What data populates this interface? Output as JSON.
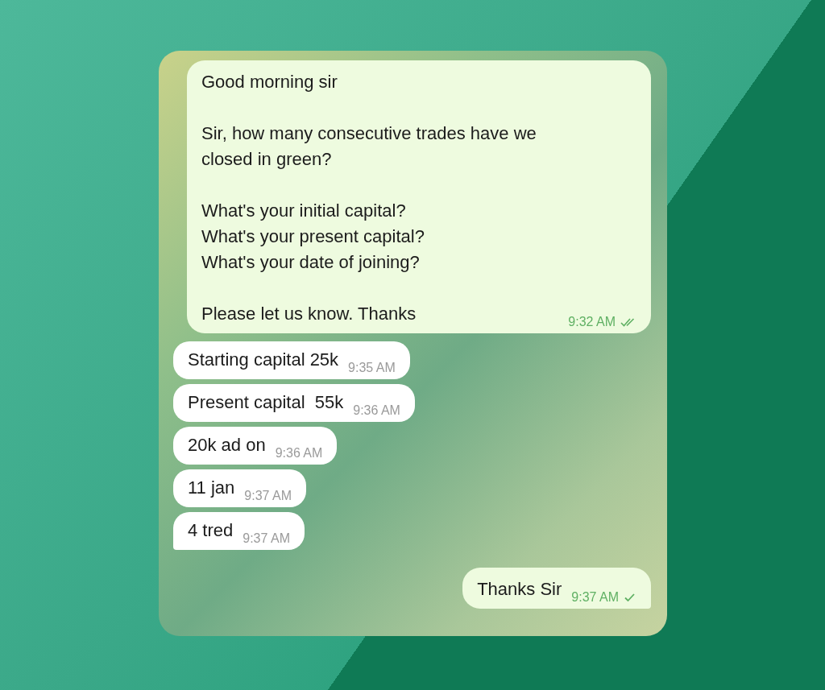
{
  "messages": [
    {
      "kind": "outgoing",
      "text": "Good morning sir\n\nSir, how many consecutive trades have we closed in green?\n\nWhat's your initial capital?\nWhat's your present capital?\nWhat's your date of joining?\n\nPlease let us know. Thanks",
      "time": "9:32 AM",
      "read": true,
      "tail": false
    },
    {
      "kind": "incoming",
      "text": "Starting capital 25k",
      "time": "9:35 AM",
      "tail": false
    },
    {
      "kind": "incoming",
      "text": "Present capital  55k",
      "time": "9:36 AM",
      "tail": false
    },
    {
      "kind": "incoming",
      "text": "20k ad on",
      "time": "9:36 AM",
      "tail": false
    },
    {
      "kind": "incoming",
      "text": "11 jan",
      "time": "9:37 AM",
      "tail": false
    },
    {
      "kind": "incoming",
      "text": "4 tred",
      "time": "9:37 AM",
      "tail": true
    },
    {
      "kind": "outgoing",
      "text": "Thanks Sir",
      "time": "9:37 AM",
      "read": false,
      "tail": true
    }
  ]
}
